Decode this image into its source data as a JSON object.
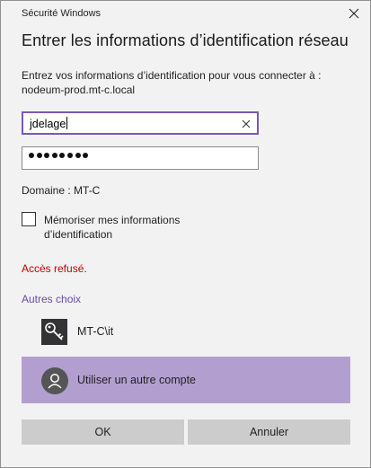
{
  "window": {
    "title": "Sécurité Windows",
    "close_icon": "close-icon"
  },
  "heading": "Entrer les informations d’identification réseau",
  "prompt": {
    "line1": "Entrez vos informations d’identification pour vous connecter à :",
    "line2": "nodeum-prod.mt-c.local"
  },
  "username": {
    "value": "jdelage",
    "clear_icon": "clear-text-icon",
    "focused": true
  },
  "password": {
    "masked_value": "••••••••",
    "length": 8
  },
  "domain": "Domaine : MT-C",
  "remember": {
    "checked": false,
    "label": "Mémoriser mes informations d’identification"
  },
  "error": {
    "text": "Accès refusé.",
    "color": "#c20000"
  },
  "more_choices": {
    "label": "Autres choix",
    "accounts": [
      {
        "label": "MT-C\\it",
        "icon": "key-icon",
        "selected": false
      },
      {
        "label": "Utiliser un autre compte",
        "icon": "user-avatar-icon",
        "selected": true
      }
    ]
  },
  "buttons": {
    "ok": "OK",
    "cancel": "Annuler"
  },
  "colors": {
    "accent": "#7a57b8",
    "selected_row": "#b39fcf",
    "link": "#6b4aa8",
    "button": "#cccccc",
    "background": "#f2f2f2"
  }
}
